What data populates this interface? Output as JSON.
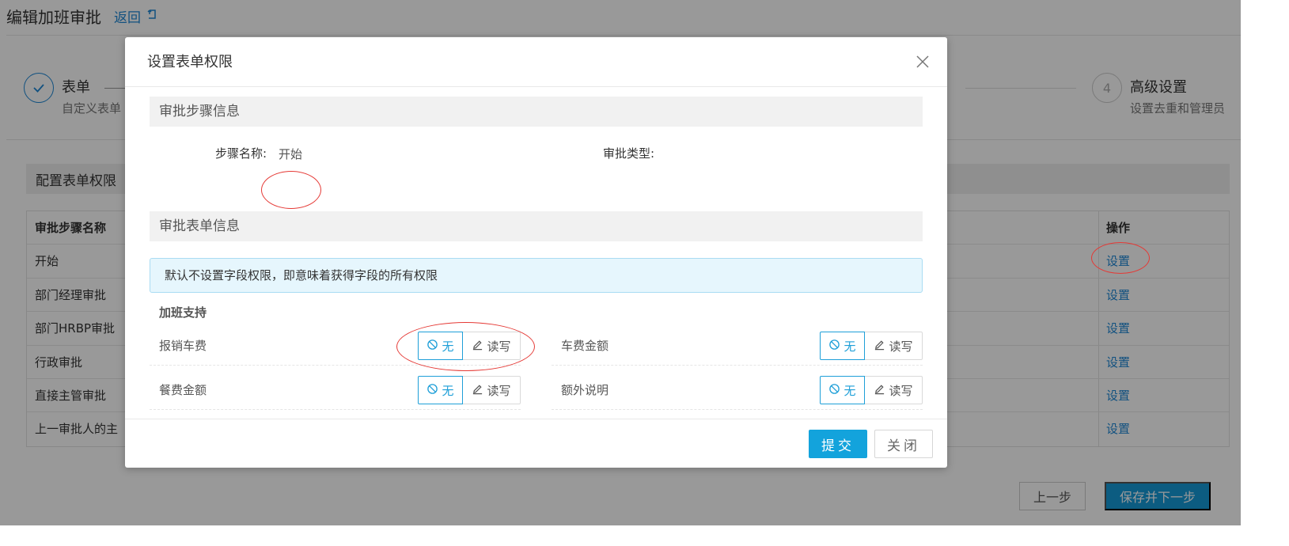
{
  "page": {
    "title": "编辑加班审批",
    "back_label": "返回"
  },
  "steps": [
    {
      "index": "1",
      "title": "表单",
      "desc": "自定义表单"
    },
    {
      "index": "4",
      "title": "高级设置",
      "desc": "设置去重和管理员"
    }
  ],
  "config_section": {
    "title": "配置表单权限"
  },
  "steps_table": {
    "columns": {
      "name": "审批步骤名称",
      "action": "操作"
    },
    "rows": [
      {
        "name": "开始",
        "action": "设置"
      },
      {
        "name": "部门经理审批",
        "action": "设置"
      },
      {
        "name": "部门HRBP审批",
        "action": "设置"
      },
      {
        "name": "行政审批",
        "action": "设置"
      },
      {
        "name": "直接主管审批",
        "action": "设置"
      },
      {
        "name": "上一审批人的主",
        "action": "设置"
      }
    ]
  },
  "page_footer": {
    "prev_label": "上一步",
    "next_label": "保存并下一步"
  },
  "modal": {
    "title": "设置表单权限",
    "step_info": {
      "section_title": "审批步骤信息",
      "step_name_label": "步骤名称:",
      "step_name_value": "开始",
      "approval_type_label": "审批类型:"
    },
    "form_info": {
      "section_title": "审批表单信息",
      "notice": "默认不设置字段权限，即意味着获得字段的所有权限",
      "group_title": "加班支持",
      "fields": [
        {
          "label": "报销车费",
          "none_label": "无",
          "rw_label": "读写",
          "selected": "none"
        },
        {
          "label": "车费金额",
          "none_label": "无",
          "rw_label": "读写",
          "selected": "none"
        },
        {
          "label": "餐费金额",
          "none_label": "无",
          "rw_label": "读写",
          "selected": "none"
        },
        {
          "label": "额外说明",
          "none_label": "无",
          "rw_label": "读写",
          "selected": "none"
        }
      ]
    },
    "footer": {
      "submit_label": "提交",
      "close_label": "关闭"
    }
  },
  "colors": {
    "primary": "#13a3dc",
    "link": "#1e88d6",
    "annotation": "#e53935",
    "overlay": "rgba(0,0,0,0.4)"
  }
}
